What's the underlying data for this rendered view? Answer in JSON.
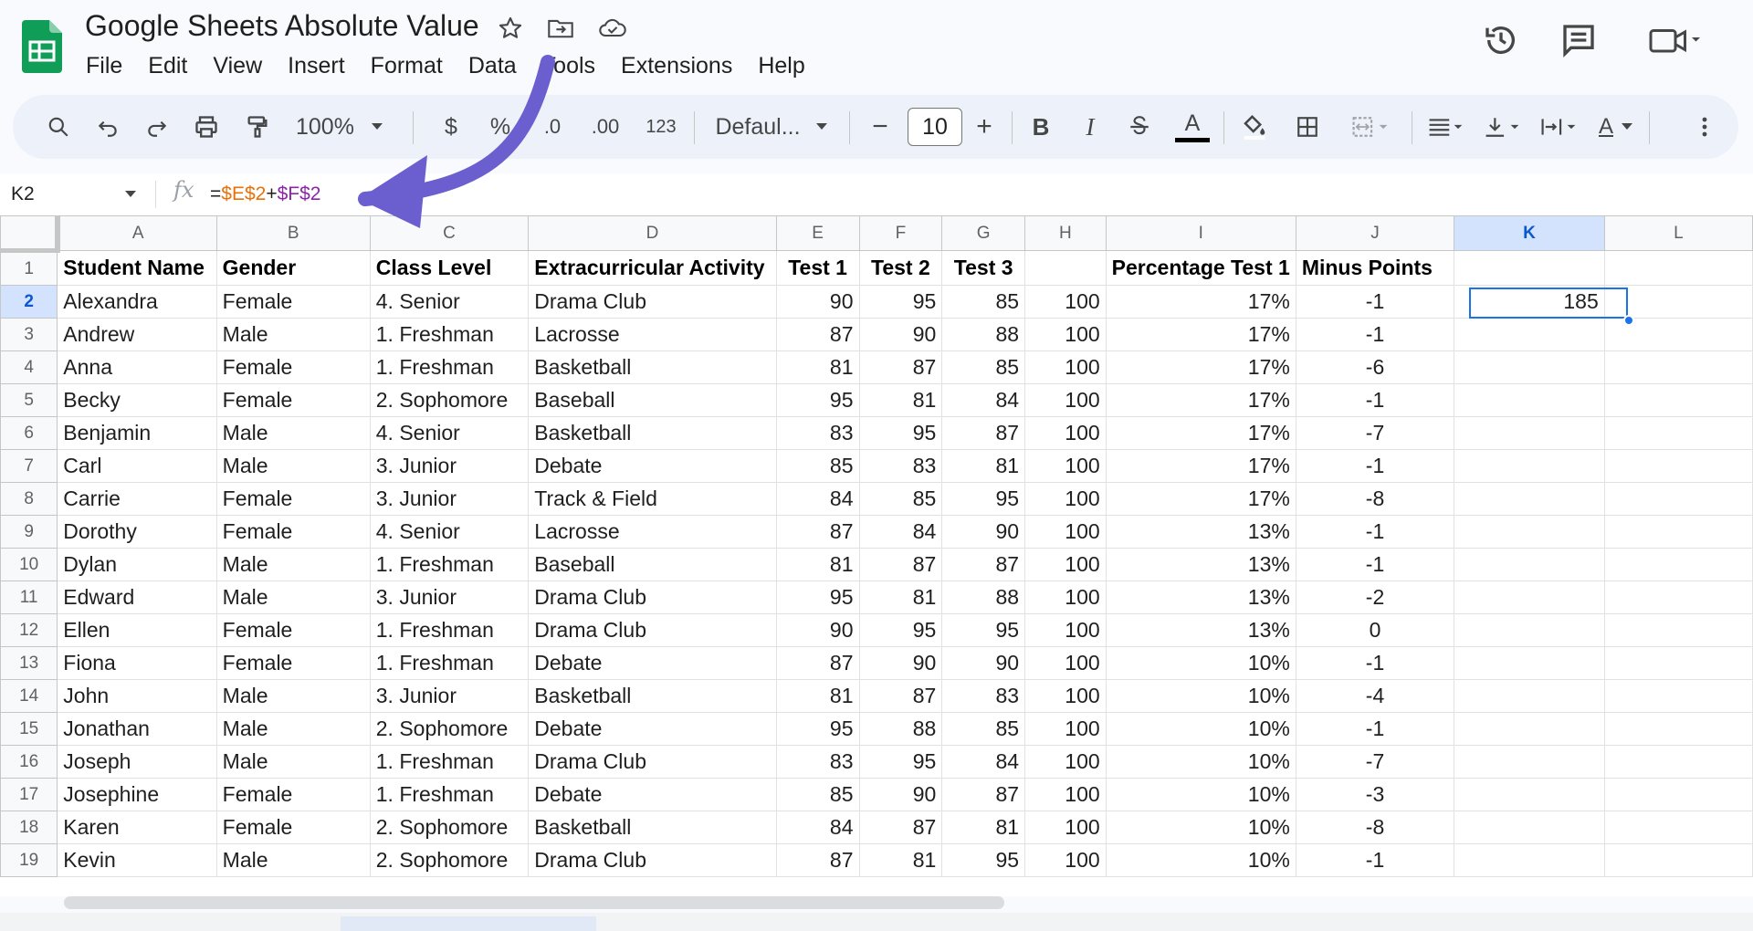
{
  "app": {
    "title": "Google Sheets Absolute Value",
    "menu": [
      "File",
      "Edit",
      "View",
      "Insert",
      "Format",
      "Data",
      "Tools",
      "Extensions",
      "Help"
    ]
  },
  "toolbar": {
    "zoom": "100%",
    "currency": "$",
    "percent": "%",
    "decrease_decimal": ".0",
    "increase_decimal": ".00",
    "number_format": "123",
    "font": "Defaul...",
    "font_size": "10",
    "minus": "−",
    "plus": "+",
    "bold": "B",
    "italic": "I",
    "text_color_glyph": "A",
    "text_rotation_glyph": "A"
  },
  "formula_bar": {
    "name_box": "K2",
    "fx": "fx",
    "formula_prefix": "=",
    "ref1": "$E$2",
    "op": "+",
    "ref2": "$F$2"
  },
  "columns": [
    "A",
    "B",
    "C",
    "D",
    "E",
    "F",
    "G",
    "H",
    "I",
    "J",
    "K",
    "L"
  ],
  "selected": {
    "column": "K",
    "row": 2,
    "value": "185"
  },
  "header_row": [
    "Student Name",
    "Gender",
    "Class Level",
    "Extracurricular Activity",
    "Test 1",
    "Test 2",
    "Test 3",
    "",
    "Percentage Test 1",
    "Minus Points",
    "",
    ""
  ],
  "rows": [
    [
      "Alexandra",
      "Female",
      "4. Senior",
      "Drama Club",
      "90",
      "95",
      "85",
      "100",
      "17%",
      "-1",
      "185",
      ""
    ],
    [
      "Andrew",
      "Male",
      "1. Freshman",
      "Lacrosse",
      "87",
      "90",
      "88",
      "100",
      "17%",
      "-1",
      "",
      ""
    ],
    [
      "Anna",
      "Female",
      "1. Freshman",
      "Basketball",
      "81",
      "87",
      "85",
      "100",
      "17%",
      "-6",
      "",
      ""
    ],
    [
      "Becky",
      "Female",
      "2. Sophomore",
      "Baseball",
      "95",
      "81",
      "84",
      "100",
      "17%",
      "-1",
      "",
      ""
    ],
    [
      "Benjamin",
      "Male",
      "4. Senior",
      "Basketball",
      "83",
      "95",
      "87",
      "100",
      "17%",
      "-7",
      "",
      ""
    ],
    [
      "Carl",
      "Male",
      "3. Junior",
      "Debate",
      "85",
      "83",
      "81",
      "100",
      "17%",
      "-1",
      "",
      ""
    ],
    [
      "Carrie",
      "Female",
      "3. Junior",
      "Track & Field",
      "84",
      "85",
      "95",
      "100",
      "17%",
      "-8",
      "",
      ""
    ],
    [
      "Dorothy",
      "Female",
      "4. Senior",
      "Lacrosse",
      "87",
      "84",
      "90",
      "100",
      "13%",
      "-1",
      "",
      ""
    ],
    [
      "Dylan",
      "Male",
      "1. Freshman",
      "Baseball",
      "81",
      "87",
      "87",
      "100",
      "13%",
      "-1",
      "",
      ""
    ],
    [
      "Edward",
      "Male",
      "3. Junior",
      "Drama Club",
      "95",
      "81",
      "88",
      "100",
      "13%",
      "-2",
      "",
      ""
    ],
    [
      "Ellen",
      "Female",
      "1. Freshman",
      "Drama Club",
      "90",
      "95",
      "95",
      "100",
      "13%",
      "0",
      "",
      ""
    ],
    [
      "Fiona",
      "Female",
      "1. Freshman",
      "Debate",
      "87",
      "90",
      "90",
      "100",
      "10%",
      "-1",
      "",
      ""
    ],
    [
      "John",
      "Male",
      "3. Junior",
      "Basketball",
      "81",
      "87",
      "83",
      "100",
      "10%",
      "-4",
      "",
      ""
    ],
    [
      "Jonathan",
      "Male",
      "2. Sophomore",
      "Debate",
      "95",
      "88",
      "85",
      "100",
      "10%",
      "-1",
      "",
      ""
    ],
    [
      "Joseph",
      "Male",
      "1. Freshman",
      "Drama Club",
      "83",
      "95",
      "84",
      "100",
      "10%",
      "-7",
      "",
      ""
    ],
    [
      "Josephine",
      "Female",
      "1. Freshman",
      "Debate",
      "85",
      "90",
      "87",
      "100",
      "10%",
      "-3",
      "",
      ""
    ],
    [
      "Karen",
      "Female",
      "2. Sophomore",
      "Basketball",
      "84",
      "87",
      "81",
      "100",
      "10%",
      "-8",
      "",
      ""
    ],
    [
      "Kevin",
      "Male",
      "2. Sophomore",
      "Drama Club",
      "87",
      "81",
      "95",
      "100",
      "10%",
      "-1",
      "",
      ""
    ]
  ],
  "colors": {
    "accent": "#1a73e8",
    "arrow": "#6b5fd0",
    "green_logo": "#0f9d58"
  }
}
